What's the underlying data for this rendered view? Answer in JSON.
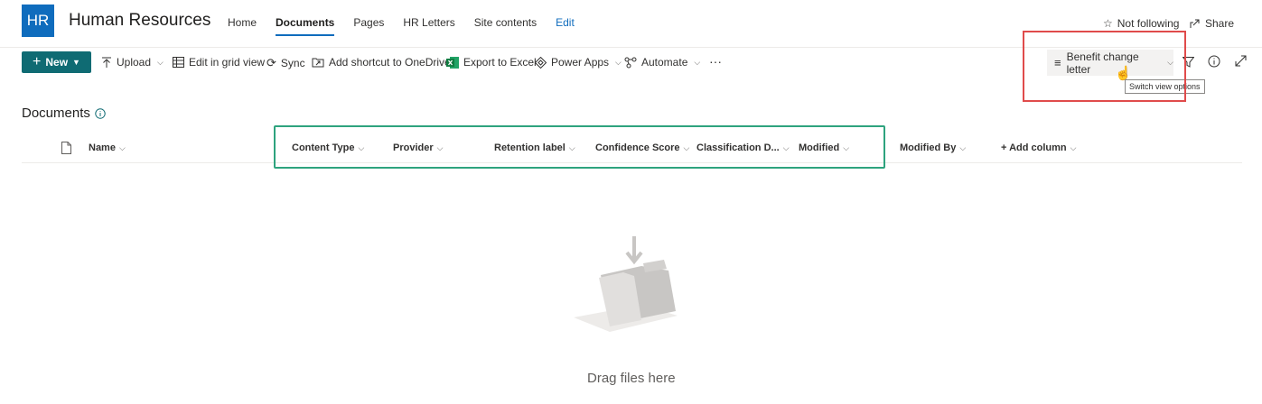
{
  "header": {
    "logo_text": "HR",
    "site_title": "Human Resources",
    "nav": [
      "Home",
      "Documents",
      "Pages",
      "HR Letters",
      "Site contents",
      "Edit"
    ],
    "active_nav": "Documents",
    "follow_label": "Not following",
    "share_label": "Share"
  },
  "commandbar": {
    "new_label": "New",
    "upload_label": "Upload",
    "grid_label": "Edit in grid view",
    "sync_label": "Sync",
    "shortcut_label": "Add shortcut to OneDrive",
    "excel_label": "Export to Excel",
    "powerapps_label": "Power Apps",
    "automate_label": "Automate",
    "more_label": "···",
    "view_label": "Benefit change letter",
    "tooltip": "Switch view options"
  },
  "list": {
    "title": "Documents",
    "columns": [
      "Name",
      "Content Type",
      "Provider",
      "Retention label",
      "Confidence Score",
      "Classification D...",
      "Modified",
      "Modified By"
    ],
    "add_column": "+ Add column",
    "empty_text": "Drag files here"
  },
  "colors": {
    "brand_blue": "#0f6cbd",
    "new_button": "#0f6b73",
    "highlight_red": "#e04b4b",
    "highlight_green": "#2ea37e"
  }
}
